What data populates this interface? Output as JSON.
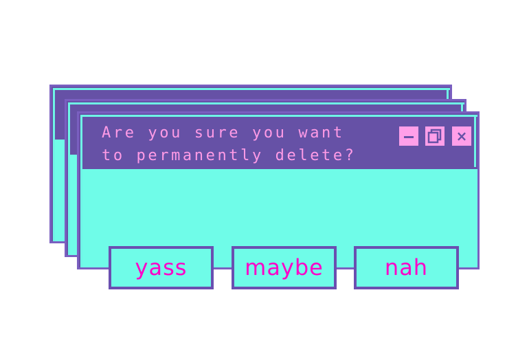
{
  "dialog": {
    "title_line1": "Are you sure you want",
    "title_line2": "to permanently delete?",
    "controls": {
      "minimize": "minimize",
      "restore": "restore",
      "close": "×"
    },
    "buttons": [
      {
        "label": "yass"
      },
      {
        "label": "maybe"
      },
      {
        "label": "nah"
      }
    ]
  },
  "colors": {
    "titlebar": "#6651a6",
    "body": "#6ffce8",
    "accent_cyan": "#6ef5e6",
    "title_text": "#ff9be6",
    "control_bg": "#ff9fe9",
    "button_text": "#ff00c8",
    "button_border": "#6a4fb0"
  }
}
